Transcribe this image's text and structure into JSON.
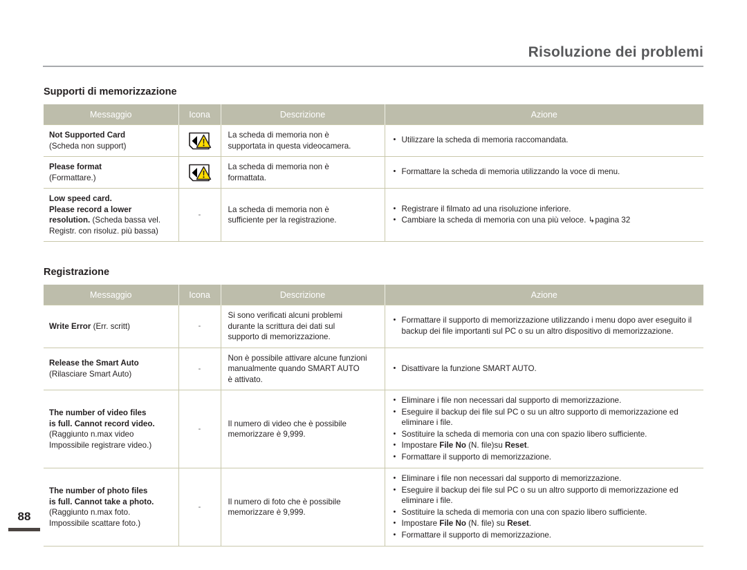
{
  "running_head": {
    "title": "Risoluzione dei problemi"
  },
  "folio": {
    "page_number": "88"
  },
  "sections": [
    {
      "id": "storage",
      "title": "Supporti di memorizzazione",
      "columns": {
        "message": "Messaggio",
        "icon": "Icona",
        "description": "Descrizione",
        "action": "Azione"
      },
      "rows": [
        {
          "message_en": "Not Supported Card",
          "message_it": "(Scheda non support)",
          "icon": "memory-card-warning-icon",
          "description": [
            "La scheda di memoria non è",
            "supportata in questa videocamera."
          ],
          "actions": [
            "Utilizzare la scheda di memoria raccomandata."
          ]
        },
        {
          "message_en": "Please format",
          "message_it": "(Formattare.)",
          "icon": "memory-card-warning-icon",
          "description": [
            "La scheda di memoria non è",
            "formattata."
          ],
          "actions": [
            "Formattare la scheda di memoria utilizzando la voce di menu."
          ]
        },
        {
          "message_en": "Low speed card.",
          "message_en_2": "Please record a lower",
          "message_en_3": "resolution.",
          "message_it": " (Scheda bassa vel.",
          "message_it_2": "Registr. con risoluz. più bassa)",
          "icon": "dash",
          "icon_text": "-",
          "description": [
            "La scheda di memoria non è",
            "sufficiente per la registrazione."
          ],
          "actions": [
            "Registrare il filmato ad una risoluzione inferiore.",
            "Cambiare la scheda di memoria con una più veloce. ↳pagina 32"
          ]
        }
      ]
    },
    {
      "id": "recording",
      "title": "Registrazione",
      "columns": {
        "message": "Messaggio",
        "icon": "Icona",
        "description": "Descrizione",
        "action": "Azione"
      },
      "rows": [
        {
          "message_en": "Write Error",
          "message_it": " (Err. scritt)",
          "icon": "dash",
          "icon_text": "-",
          "description": [
            "Si sono verificati alcuni problemi",
            "durante la scrittura dei dati sul",
            "supporto di memorizzazione."
          ],
          "actions": [
            "Formattare il supporto di memorizzazione utilizzando i menu dopo aver eseguito il backup dei file importanti sul PC o su un altro dispositivo di memorizzazione."
          ]
        },
        {
          "message_en": "Release the Smart Auto",
          "message_it": "(Rilasciare Smart Auto)",
          "icon": "dash",
          "icon_text": "-",
          "description": [
            "Non è possibile attivare alcune funzioni",
            "manualmente quando SMART AUTO",
            "è attivato."
          ],
          "actions": [
            "Disattivare la funzione SMART AUTO."
          ]
        },
        {
          "message_en": "The number of video files",
          "message_en_2": "is full. Cannot record video.",
          "message_it": "(Raggiunto n.max video",
          "message_it_2": "Impossibile registrare video.)",
          "icon": "dash",
          "icon_text": "-",
          "description": [
            "Il numero di video che è possibile",
            "memorizzare è 9,999."
          ],
          "actions_rich": [
            [
              {
                "t": "Eliminare i file non necessari dal supporto di memorizzazione.",
                "b": false
              }
            ],
            [
              {
                "t": "Eseguire il backup dei file sul PC o su un altro supporto di memorizzazione ed eliminare i file.",
                "b": false
              }
            ],
            [
              {
                "t": "Sostituire la scheda di memoria con una con spazio libero sufficiente.",
                "b": false
              }
            ],
            [
              {
                "t": "Impostare ",
                "b": false
              },
              {
                "t": "File No",
                "b": true
              },
              {
                "t": " (N. file)su ",
                "b": false
              },
              {
                "t": "Reset",
                "b": true
              },
              {
                "t": ".",
                "b": false
              }
            ],
            [
              {
                "t": "Formattare il supporto di memorizzazione.",
                "b": false
              }
            ]
          ]
        },
        {
          "message_en": "The number of photo files",
          "message_en_2": "is full. Cannot take a photo.",
          "message_it": "(Raggiunto n.max foto.",
          "message_it_2": "Impossibile scattare foto.)",
          "icon": "dash",
          "icon_text": "-",
          "description": [
            "Il numero di foto che è possibile",
            "memorizzare è 9,999."
          ],
          "actions_rich": [
            [
              {
                "t": "Eliminare i file non necessari dal supporto di memorizzazione.",
                "b": false
              }
            ],
            [
              {
                "t": "Eseguire il backup dei file sul PC o su un altro supporto di memorizzazione ed eliminare i file.",
                "b": false
              }
            ],
            [
              {
                "t": "Sostituire la scheda di memoria con una con spazio libero sufficiente.",
                "b": false
              }
            ],
            [
              {
                "t": "Impostare ",
                "b": false
              },
              {
                "t": "File No",
                "b": true
              },
              {
                "t": " (N. file) su ",
                "b": false
              },
              {
                "t": "Reset",
                "b": true
              },
              {
                "t": ".",
                "b": false
              }
            ],
            [
              {
                "t": "Formattare il supporto di memorizzazione.",
                "b": false
              }
            ]
          ]
        }
      ]
    }
  ],
  "colors": {
    "header_band": "#bdbdab",
    "rule": "#a7a9ac",
    "border": "#c9c8ab",
    "folio_bar": "#4b4441",
    "warning_yellow": "#ffdd00",
    "text": "#231f20"
  }
}
